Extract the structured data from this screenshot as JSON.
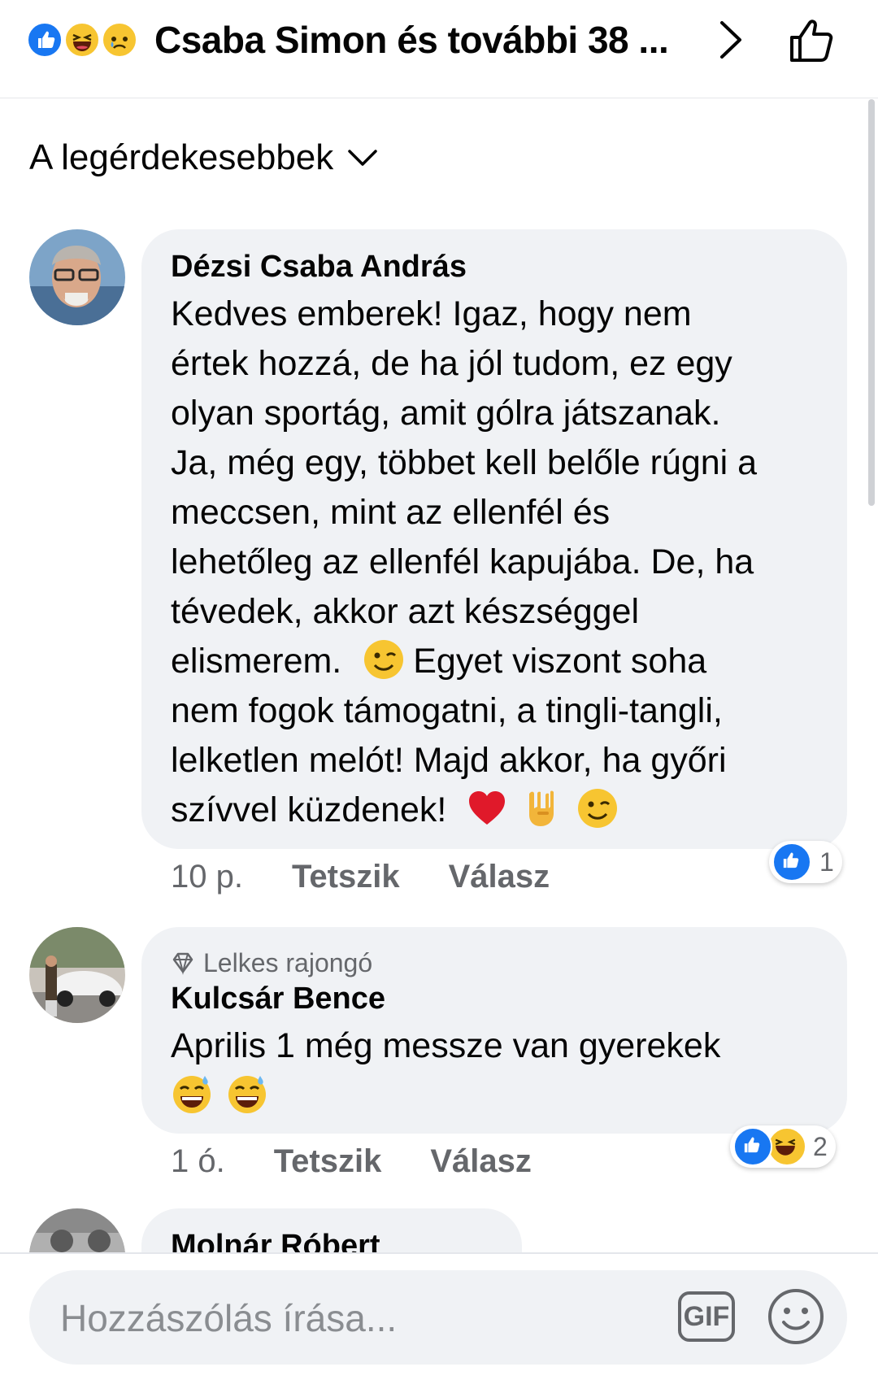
{
  "header": {
    "title": "Csaba Simon és további 38 ...",
    "reaction_icons": [
      "like-reaction-icon",
      "haha-reaction-icon",
      "sad-reaction-icon"
    ]
  },
  "sort": {
    "label": "A legérdekesebbek"
  },
  "comments": [
    {
      "author": "Dézsi Csaba András",
      "text_lines": [
        "Kedves emberek! Igaz, hogy nem",
        "értek hozzá, de ha jól tudom, ez egy",
        "olyan sportág, amit gólra játszanak.",
        "Ja, még egy, többet kell belőle rúgni a",
        "meccsen, mint az ellenfél és",
        "lehetőleg az ellenfél kapujába. De, ha",
        "tévedek, akkor azt készséggel",
        "elismerem.",
        "Egyet viszont soha",
        "nem fogok támogatni, a tingli-tangli,",
        "lelketlen melót! Majd akkor, ha győri",
        "szívvel küzdenek!"
      ],
      "time": "10 p.",
      "like_label": "Tetszik",
      "reply_label": "Válasz",
      "reaction_count": "1"
    },
    {
      "badge": "Lelkes rajongó",
      "author": "Kulcsár Bence",
      "text": "Aprilis 1 még messze van gyerekek",
      "time": "1 ó.",
      "like_label": "Tetszik",
      "reply_label": "Válasz",
      "reaction_count": "2"
    },
    {
      "author": "Molnár Róbert"
    }
  ],
  "composer": {
    "placeholder": "Hozzászólás írása...",
    "gif_label": "GIF"
  },
  "colors": {
    "accent": "#1877f2",
    "bubble": "#f0f2f5",
    "secondary_text": "#65676b",
    "heart": "#e0192a",
    "emoji_yellow": "#f7c531"
  }
}
